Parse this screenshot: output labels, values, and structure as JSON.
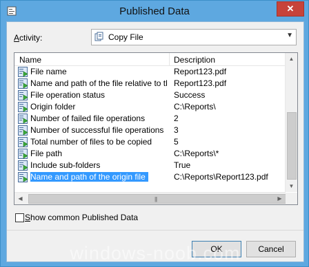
{
  "window": {
    "title": "Published Data",
    "close_glyph": "✕"
  },
  "activity": {
    "label": "Activity:",
    "access_key": "A",
    "label_rest": "ctivity:",
    "value": "Copy File"
  },
  "list": {
    "columns": [
      "Name",
      "Description"
    ],
    "rows": [
      {
        "name": "File name",
        "desc": "Report123.pdf",
        "selected": false
      },
      {
        "name": "Name and path of the file relative to th...",
        "desc": "Report123.pdf",
        "selected": false
      },
      {
        "name": "File operation status",
        "desc": "Success",
        "selected": false
      },
      {
        "name": "Origin folder",
        "desc": "C:\\Reports\\",
        "selected": false
      },
      {
        "name": "Number of failed file operations",
        "desc": "2",
        "selected": false
      },
      {
        "name": "Number of successful file operations",
        "desc": "3",
        "selected": false
      },
      {
        "name": "Total number of files to be copied",
        "desc": "5",
        "selected": false
      },
      {
        "name": "File path",
        "desc": "C:\\Reports\\*",
        "selected": false
      },
      {
        "name": "Include sub-folders",
        "desc": "True",
        "selected": false
      },
      {
        "name": "Name and path of the origin file",
        "desc": "C:\\Reports\\Report123.pdf",
        "selected": true
      }
    ],
    "vertical_scroll_fraction": 1.0
  },
  "checkbox": {
    "label": "Show common Published Data",
    "access_key": "S",
    "label_rest": "how common Published Data",
    "checked": false
  },
  "buttons": {
    "ok": "OK",
    "cancel": "Cancel"
  },
  "watermark": "windows-noob.com",
  "colors": {
    "titlebar": "#5ea8e0",
    "selection": "#3399ff",
    "close": "#c7433a"
  },
  "icons": {
    "title": "dialog-icon",
    "combo": "activity-icon",
    "row": "published-data-icon"
  }
}
